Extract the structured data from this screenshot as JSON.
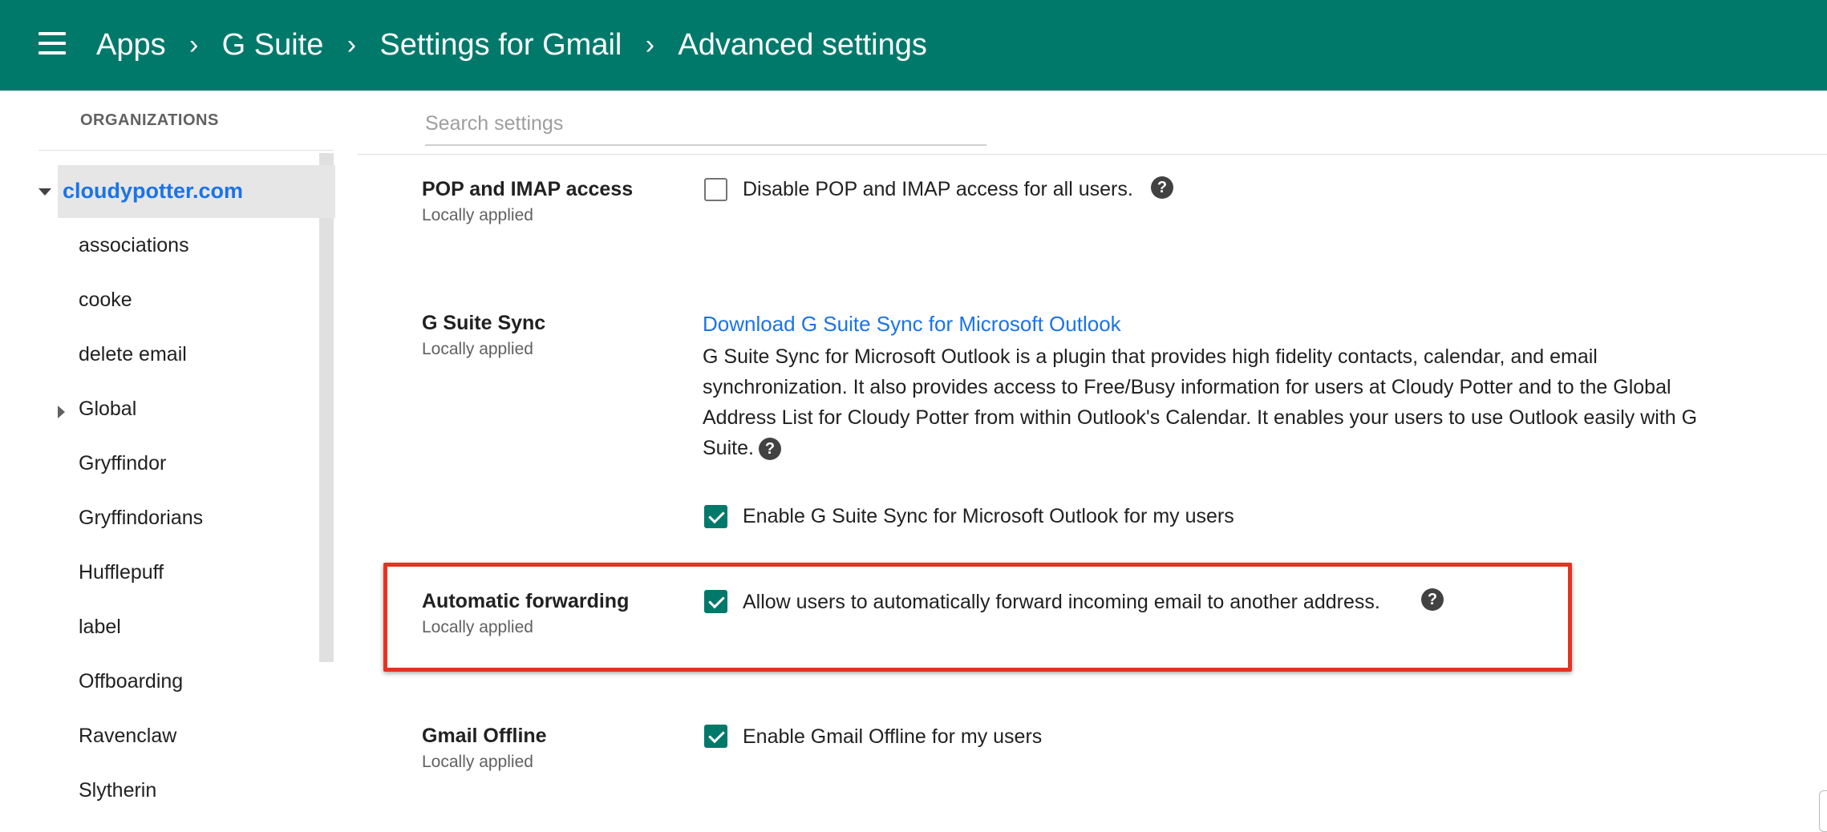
{
  "header": {
    "breadcrumbs": [
      "Apps",
      "G Suite",
      "Settings for Gmail",
      "Advanced settings"
    ],
    "separator": "›",
    "color": "#00796b"
  },
  "sidebar": {
    "title": "ORGANIZATIONS",
    "root": "cloudypotter.com",
    "items": [
      "associations",
      "cooke",
      "delete email",
      "Global",
      "Gryffindor",
      "Gryffindorians",
      "Hufflepuff",
      "label",
      "Offboarding",
      "Ravenclaw",
      "Slytherin"
    ]
  },
  "search": {
    "placeholder": "Search settings",
    "value": ""
  },
  "settings": {
    "pop_imap": {
      "title": "POP and IMAP access",
      "subtitle": "Locally applied",
      "checkbox_label": "Disable POP and IMAP access for all users.",
      "checked": false
    },
    "gsuite_sync": {
      "title": "G Suite Sync",
      "subtitle": "Locally applied",
      "link": "Download G Suite Sync for Microsoft Outlook",
      "description": "G Suite Sync for Microsoft Outlook is a plugin that provides high fidelity contacts, calendar, and email synchronization. It also provides access to Free/Busy information for users at Cloudy Potter and to the Global Address List for Cloudy Potter from within Outlook's Calendar. It enables your users to use Outlook easily with G Suite.",
      "checkbox_label": "Enable G Suite Sync for Microsoft Outlook for my users",
      "checked": true
    },
    "auto_forward": {
      "title": "Automatic forwarding",
      "subtitle": "Locally applied",
      "checkbox_label": "Allow users to automatically forward incoming email to another address.",
      "checked": true
    },
    "gmail_offline": {
      "title": "Gmail Offline",
      "subtitle": "Locally applied",
      "checkbox_label": "Enable Gmail Offline for my users",
      "checked": true
    }
  },
  "icons": {
    "menu": "menu-icon",
    "help": "?"
  },
  "colors": {
    "accent": "#00796b",
    "link": "#1a73e8",
    "highlight": "#e53322"
  }
}
